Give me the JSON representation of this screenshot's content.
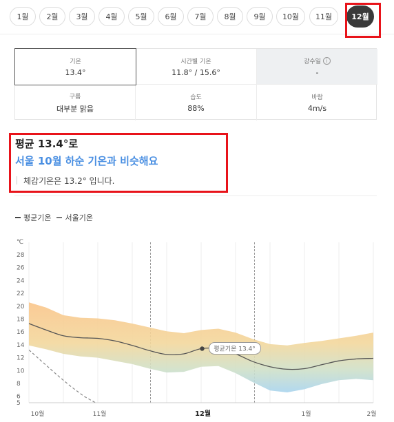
{
  "months": [
    "1월",
    "2월",
    "3월",
    "4월",
    "5월",
    "6월",
    "7월",
    "8월",
    "9월",
    "10월",
    "11월",
    "12월"
  ],
  "active_month_index": 11,
  "stats": {
    "temp": {
      "label": "기온",
      "value": "13.4°"
    },
    "hourly": {
      "label": "시간별 기온",
      "value": "11.8° / 15.6°"
    },
    "rain": {
      "label": "강수일",
      "value": "-"
    },
    "cloud": {
      "label": "구름",
      "value": "대부분 맑음"
    },
    "humidity": {
      "label": "습도",
      "value": "88%"
    },
    "wind": {
      "label": "바람",
      "value": "4m/s"
    }
  },
  "summary": {
    "title": "평균 13.4°로",
    "subtitle": "서울 10월 하순 기온과 비슷해요",
    "feel": "체감기온은 13.2° 입니다."
  },
  "legend": {
    "avg": "평균기온",
    "seoul": "서울기온"
  },
  "colors": {
    "highlight": "#e8131a",
    "accent": "#4a8fe2",
    "band_warm": "#f9c98a",
    "band_cool": "#a9d4ee"
  },
  "chart_data": {
    "type": "area",
    "unit_label": "℃",
    "yticks": [
      5,
      6,
      8,
      10,
      12,
      14,
      16,
      18,
      20,
      22,
      24,
      26,
      28
    ],
    "ylim": [
      5,
      29
    ],
    "xlim": [
      0,
      100
    ],
    "xticks": [
      {
        "x": 2.5,
        "label": "10월",
        "bold": false
      },
      {
        "x": 20.5,
        "label": "11월",
        "bold": false
      },
      {
        "x": 50.5,
        "label": "12월",
        "bold": true
      },
      {
        "x": 80.5,
        "label": "1월",
        "bold": false
      },
      {
        "x": 99.5,
        "label": "2월",
        "bold": false
      }
    ],
    "dashed_markers": [
      35.3,
      65.5
    ],
    "x": [
      0,
      5,
      10,
      15,
      20,
      25,
      30,
      35,
      40,
      45,
      50,
      55,
      60,
      65,
      70,
      75,
      80,
      85,
      90,
      95,
      100
    ],
    "avg": [
      17.3,
      16.3,
      15.4,
      15.1,
      15.0,
      14.6,
      13.9,
      13.1,
      12.5,
      12.6,
      13.4,
      13.4,
      12.6,
      11.4,
      10.6,
      10.2,
      10.3,
      10.9,
      11.5,
      11.8,
      11.9
    ],
    "upper": [
      20.6,
      19.8,
      18.6,
      18.2,
      18.1,
      17.8,
      17.3,
      16.7,
      16.1,
      15.8,
      16.3,
      16.5,
      15.9,
      14.9,
      14.1,
      13.9,
      14.3,
      14.6,
      15.0,
      15.4,
      15.9
    ],
    "lower": [
      13.9,
      13.3,
      12.6,
      12.2,
      12.0,
      11.5,
      11.0,
      10.3,
      9.7,
      9.8,
      10.6,
      10.7,
      9.6,
      8.2,
      6.9,
      6.6,
      7.1,
      7.9,
      8.5,
      8.7,
      8.5
    ],
    "seoul_x": [
      0,
      4,
      8,
      12,
      16,
      20
    ],
    "seoul": [
      13.2,
      11.3,
      9.4,
      7.6,
      6.0,
      4.8
    ],
    "annotation": {
      "x": 50.3,
      "y": 13.4,
      "text": "평균기온 13.4°"
    }
  }
}
